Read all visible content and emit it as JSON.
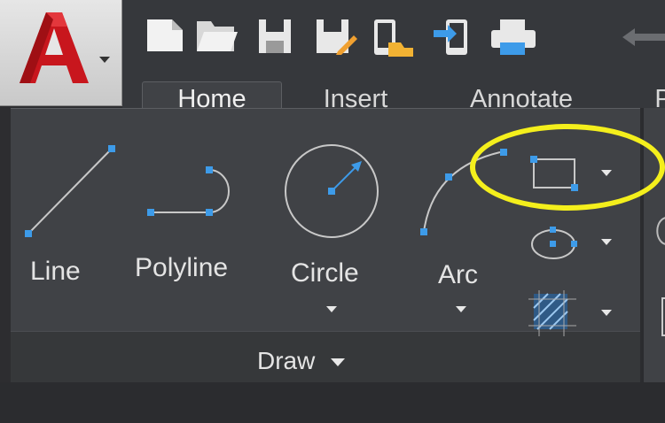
{
  "app": {
    "logo_letter": "A",
    "brand_color": "#c8161d"
  },
  "quick_access": {
    "icons": [
      "new-icon",
      "open-icon",
      "save-icon",
      "save-as-icon",
      "open-web-mobile-icon",
      "save-web-mobile-icon",
      "plot-icon",
      "undo-icon"
    ]
  },
  "tabs": [
    {
      "label": "Home",
      "active": true
    },
    {
      "label": "Insert",
      "active": false
    },
    {
      "label": "Annotate",
      "active": false
    },
    {
      "label": "P",
      "active": false
    }
  ],
  "draw_panel": {
    "title": "Draw",
    "tools": [
      {
        "label": "Line",
        "icon": "line-icon"
      },
      {
        "label": "Polyline",
        "icon": "polyline-icon"
      },
      {
        "label": "Circle",
        "icon": "circle-icon"
      },
      {
        "label": "Arc",
        "icon": "arc-icon"
      }
    ],
    "small_tools": [
      "rectangle-icon",
      "ellipse-icon",
      "hatch-icon"
    ]
  },
  "colors": {
    "highlight": "#f4ef1c",
    "grip": "#3d9be9"
  }
}
